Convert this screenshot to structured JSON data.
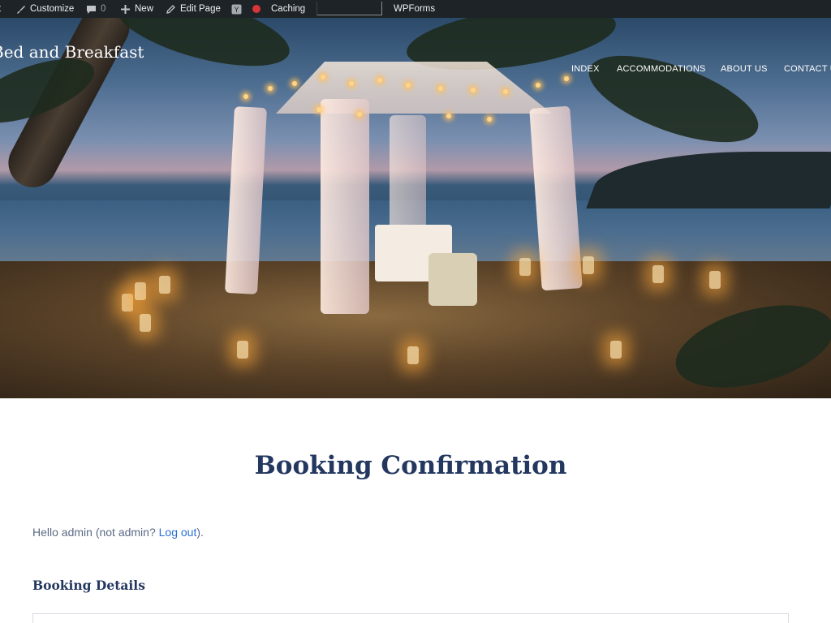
{
  "adminbar": {
    "site_edge_text": "t",
    "customize_label": "Customize",
    "comments_count": "0",
    "new_label": "New",
    "edit_page_label": "Edit Page",
    "caching_label": "Caching",
    "wpforms_label": "WPForms",
    "seo_logo": "Y"
  },
  "header": {
    "site_title": "Bed and Breakfast",
    "nav": [
      "INDEX",
      "ACCOMMODATIONS",
      "ABOUT US",
      "CONTACT US"
    ]
  },
  "main": {
    "title": "Booking Confirmation",
    "greeting_prefix": "Hello admin (not admin? ",
    "logout_label": "Log out",
    "greeting_suffix": ").",
    "booking_details_title": "Booking Details"
  },
  "colors": {
    "admin_bar_bg": "#1d2327",
    "heading": "#23375f",
    "link": "#2a6fd6",
    "caching_dot": "#d63638"
  },
  "icons": [
    "customize-brush-icon",
    "comment-bubble-icon",
    "plus-icon",
    "edit-pencil-icon",
    "yoast-seo-icon",
    "status-dot-icon"
  ]
}
